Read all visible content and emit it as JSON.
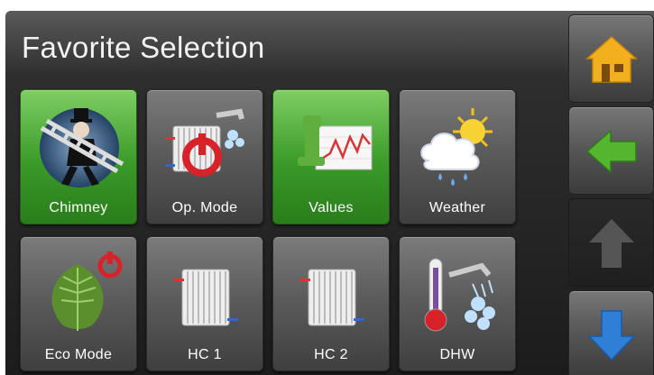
{
  "header": {
    "title": "Favorite Selection"
  },
  "tiles": [
    {
      "label": "Chimney",
      "icon": "chimney-sweep-icon",
      "active": true
    },
    {
      "label": "Op. Mode",
      "icon": "operating-mode-icon",
      "active": false
    },
    {
      "label": "Values",
      "icon": "values-chart-icon",
      "active": true
    },
    {
      "label": "Weather",
      "icon": "weather-icon",
      "active": false
    },
    {
      "label": "Eco Mode",
      "icon": "eco-leaf-icon",
      "active": false
    },
    {
      "label": "HC 1",
      "icon": "radiator-icon",
      "active": false
    },
    {
      "label": "HC 2",
      "icon": "radiator-icon",
      "active": false
    },
    {
      "label": "DHW",
      "icon": "hot-water-icon",
      "active": false
    }
  ],
  "side_nav": [
    {
      "icon": "home-icon",
      "enabled": true
    },
    {
      "icon": "back-arrow-icon",
      "enabled": true
    },
    {
      "icon": "up-arrow-icon",
      "enabled": false
    },
    {
      "icon": "down-arrow-icon",
      "enabled": true
    }
  ],
  "colors": {
    "active_tile": "#3a9a28",
    "home_icon": "#f2b01e",
    "back_arrow": "#55b52f",
    "down_arrow": "#2f7fd6"
  }
}
